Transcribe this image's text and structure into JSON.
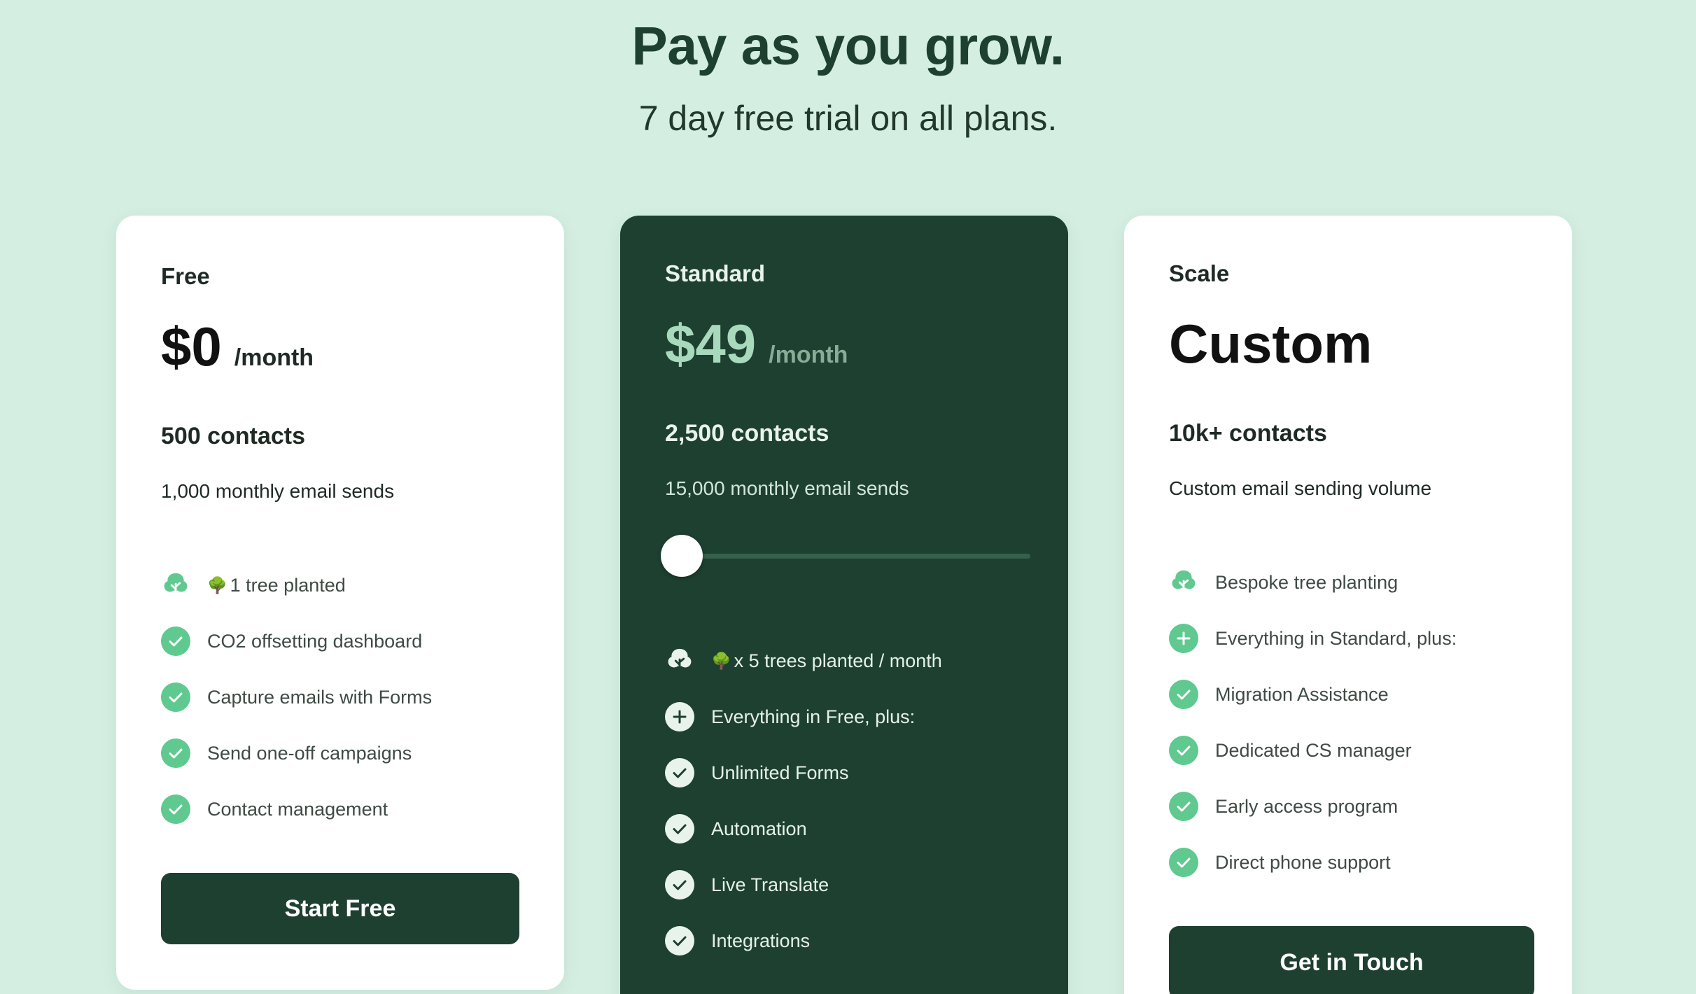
{
  "hero": {
    "title": "Pay as you grow.",
    "subtitle": "7 day free trial on all plans."
  },
  "plans": [
    {
      "name": "Free",
      "price": "$0",
      "per": "/month",
      "contacts": "500 contacts",
      "sends": "1,000 monthly email sends",
      "features": [
        {
          "icon": "tree-icon",
          "text": "1 tree planted",
          "prefix": "🌳"
        },
        {
          "icon": "check-icon",
          "text": "CO2 offsetting dashboard"
        },
        {
          "icon": "check-icon",
          "text": "Capture emails with Forms"
        },
        {
          "icon": "check-icon",
          "text": "Send one-off campaigns"
        },
        {
          "icon": "check-icon",
          "text": "Contact management"
        }
      ],
      "cta": "Start Free"
    },
    {
      "name": "Standard",
      "price": "$49",
      "per": "/month",
      "contacts": "2,500 contacts",
      "sends": "15,000 monthly email sends",
      "slider_level": 0,
      "features": [
        {
          "icon": "tree-icon",
          "text": "x 5 trees planted / month",
          "prefix": "🌳"
        },
        {
          "icon": "plus-icon",
          "text": "Everything in Free, plus:"
        },
        {
          "icon": "check-icon",
          "text": "Unlimited Forms"
        },
        {
          "icon": "check-icon",
          "text": "Automation"
        },
        {
          "icon": "check-icon",
          "text": "Live Translate"
        },
        {
          "icon": "check-icon",
          "text": "Integrations"
        }
      ]
    },
    {
      "name": "Scale",
      "price": "Custom",
      "contacts": "10k+ contacts",
      "sends": "Custom email sending volume",
      "features": [
        {
          "icon": "tree-icon",
          "text": "Bespoke tree planting"
        },
        {
          "icon": "plus-icon",
          "text": "Everything in Standard, plus:"
        },
        {
          "icon": "check-icon",
          "text": "Migration Assistance"
        },
        {
          "icon": "check-icon",
          "text": "Dedicated CS manager"
        },
        {
          "icon": "check-icon",
          "text": "Early access program"
        },
        {
          "icon": "check-icon",
          "text": "Direct phone support"
        }
      ],
      "cta": "Get in Touch"
    }
  ],
  "colors": {
    "background": "#d4efe2",
    "brand_dark": "#1e4030",
    "accent_green": "#5fc98f"
  }
}
